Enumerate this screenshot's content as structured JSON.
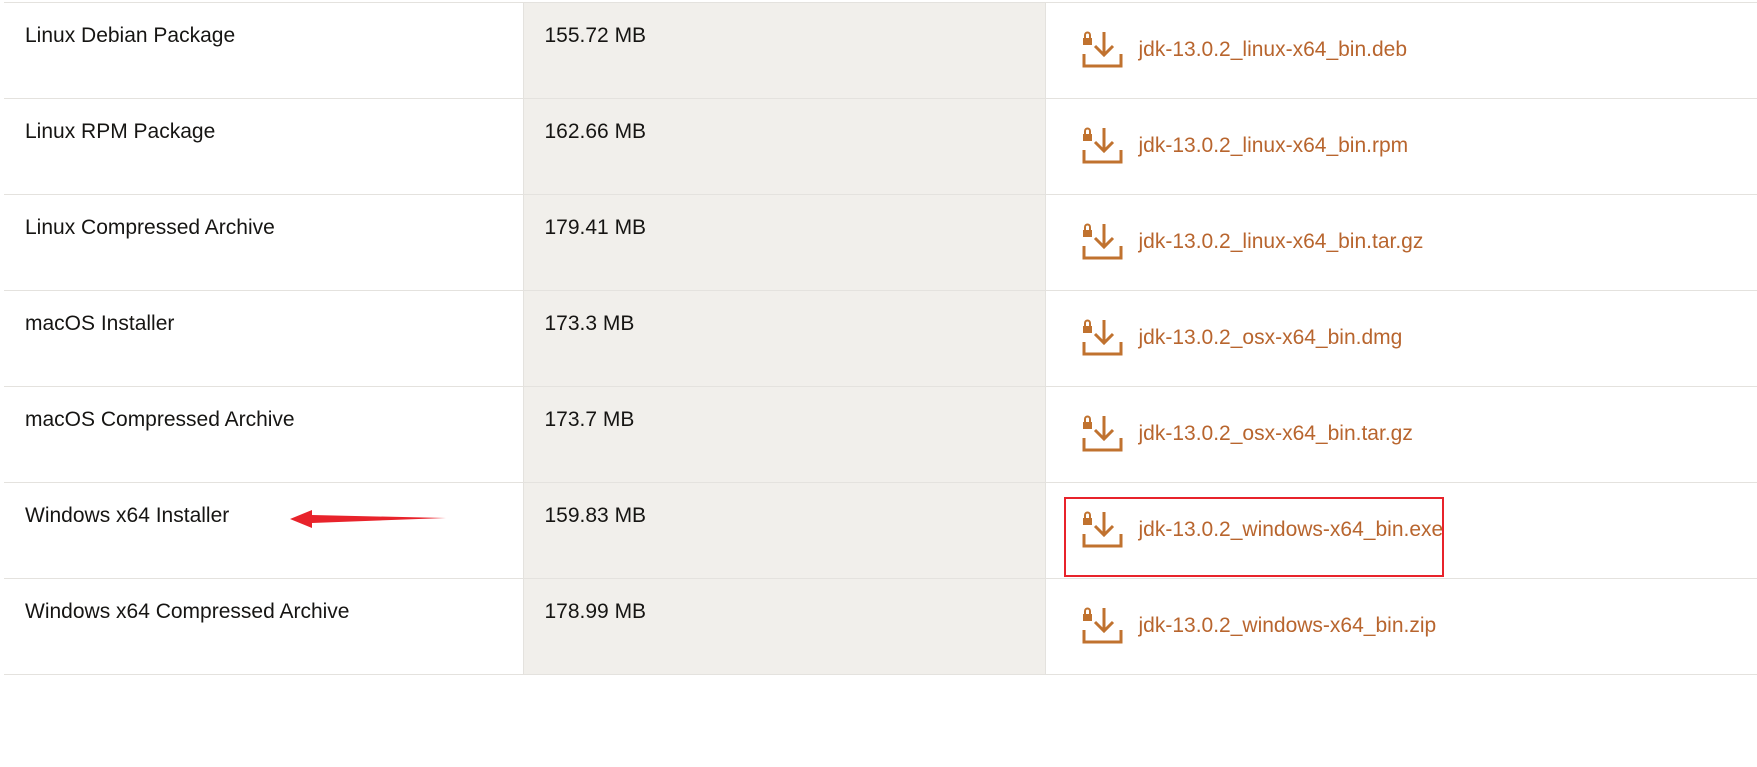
{
  "table": {
    "rows": [
      {
        "product": "Linux Debian Package",
        "size": "155.72 MB",
        "file": "jdk-13.0.2_linux-x64_bin.deb"
      },
      {
        "product": "Linux RPM Package",
        "size": "162.66 MB",
        "file": "jdk-13.0.2_linux-x64_bin.rpm"
      },
      {
        "product": "Linux Compressed Archive",
        "size": "179.41 MB",
        "file": "jdk-13.0.2_linux-x64_bin.tar.gz"
      },
      {
        "product": "macOS Installer",
        "size": "173.3 MB",
        "file": "jdk-13.0.2_osx-x64_bin.dmg"
      },
      {
        "product": "macOS Compressed Archive",
        "size": "173.7 MB",
        "file": "jdk-13.0.2_osx-x64_bin.tar.gz"
      },
      {
        "product": "Windows x64 Installer",
        "size": "159.83 MB",
        "file": "jdk-13.0.2_windows-x64_bin.exe"
      },
      {
        "product": "Windows x64 Compressed Archive",
        "size": "178.99 MB",
        "file": "jdk-13.0.2_windows-x64_bin.zip"
      }
    ]
  },
  "icons": {
    "download": "locked-download-icon",
    "annotation_arrow": "red-arrow-icon"
  },
  "colors": {
    "link": "#b8652e",
    "icon": "#c0722f",
    "size_column_bg": "#f1efeb",
    "highlight": "#e8232b",
    "text": "#161513"
  }
}
